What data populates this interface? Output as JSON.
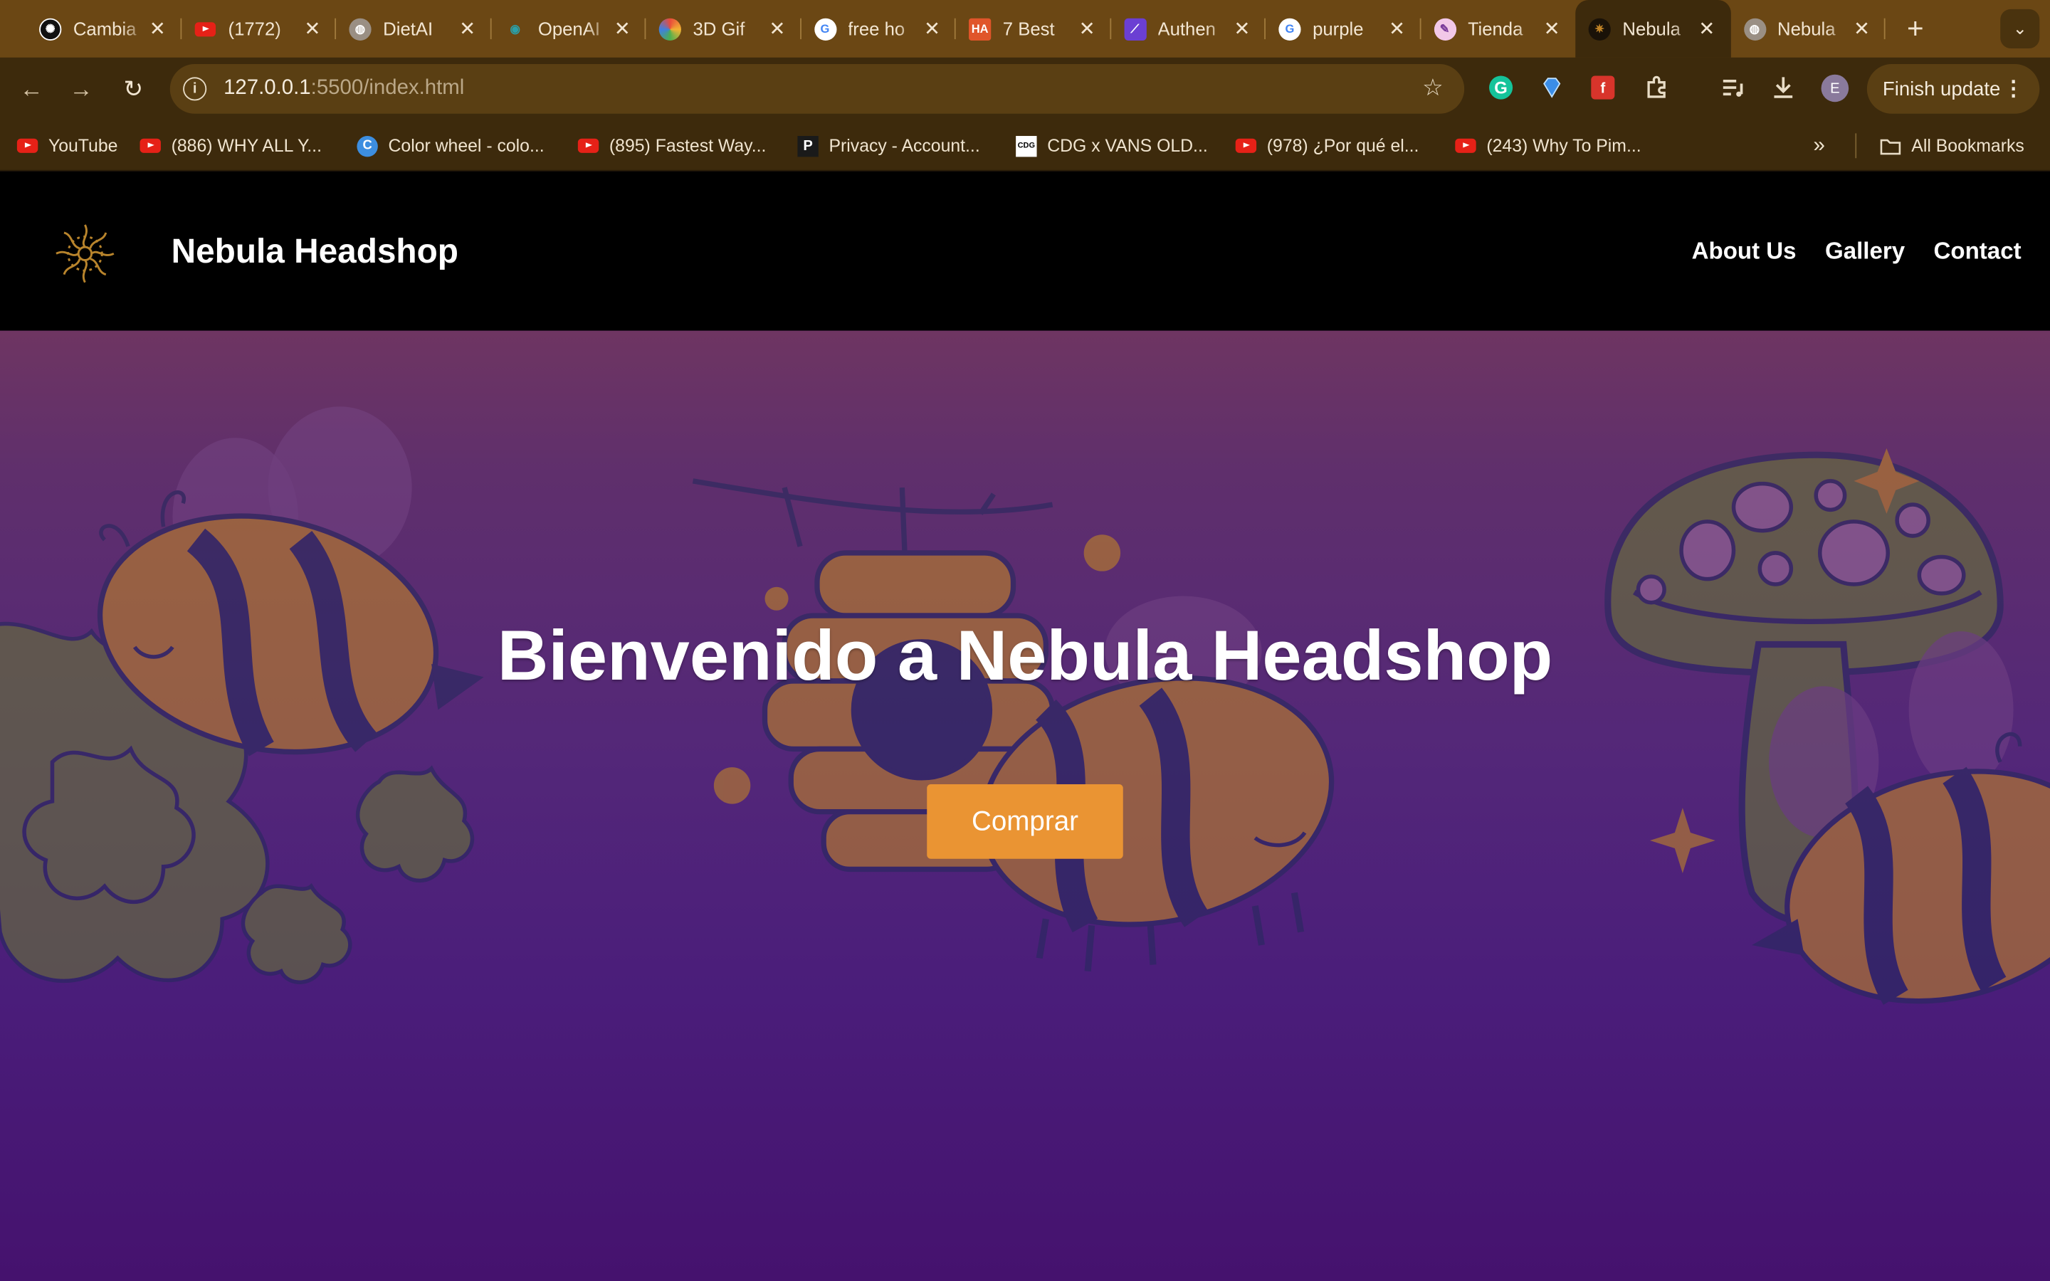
{
  "browser": {
    "tabs": [
      {
        "title": "Cambia",
        "favicon": "openai-icon",
        "color": "#111111"
      },
      {
        "title": "(1772)",
        "favicon": "youtube-icon",
        "color": "#e62117"
      },
      {
        "title": "DietAI",
        "favicon": "globe-icon",
        "color": "#9a8f84"
      },
      {
        "title": "OpenAI",
        "favicon": "openai-eye-icon",
        "color": "#1a5c6a"
      },
      {
        "title": "3D Gif",
        "favicon": "gif-icon",
        "color": "#d5a62c"
      },
      {
        "title": "free ho",
        "favicon": "google-icon",
        "color": "#ffffff"
      },
      {
        "title": "7 Best",
        "favicon": "ha-icon",
        "color": "#e0552a"
      },
      {
        "title": "Authen",
        "favicon": "auth-icon",
        "color": "#6b3fd3"
      },
      {
        "title": "purple",
        "favicon": "google-icon",
        "color": "#ffffff"
      },
      {
        "title": "Tienda",
        "favicon": "pencil-icon",
        "color": "#f2c8e8"
      },
      {
        "title": "Nebula",
        "favicon": "nebula-icon",
        "color": "#1a1208",
        "active": true
      },
      {
        "title": "Nebula",
        "favicon": "globe-icon",
        "color": "#9a8f84"
      }
    ],
    "new_tab_label": "+",
    "url_host": "127.0.0.1",
    "url_rest": ":5500/index.html",
    "finish_update_label": "Finish update",
    "avatar_letter": "E",
    "bookmarks": [
      {
        "label": "YouTube",
        "icon": "youtube-icon"
      },
      {
        "label": "(886) WHY ALL Y...",
        "icon": "youtube-icon"
      },
      {
        "label": "Color wheel - colo...",
        "icon": "canva-icon"
      },
      {
        "label": "(895) Fastest Way...",
        "icon": "youtube-icon"
      },
      {
        "label": "Privacy - Account...",
        "icon": "p-icon"
      },
      {
        "label": "CDG x VANS OLD...",
        "icon": "cdg-icon"
      },
      {
        "label": "(978) ¿Por qué el...",
        "icon": "youtube-icon"
      },
      {
        "label": "(243) Why To Pim...",
        "icon": "youtube-icon"
      }
    ],
    "all_bookmarks_label": "All Bookmarks"
  },
  "site": {
    "brand": "Nebula Headshop",
    "nav": [
      {
        "label": "About Us"
      },
      {
        "label": "Gallery"
      },
      {
        "label": "Contact"
      }
    ],
    "hero": {
      "headline": "Bienvenido a Nebula Headshop",
      "cta_label": "Comprar"
    }
  },
  "colors": {
    "chrome": "#6b4714",
    "toolbar": "#3d2a0c",
    "nav_bg": "#000000",
    "hero_top": "#6e3562",
    "hero_bottom": "#45126e",
    "cta": "#ea9433",
    "bee_yellow": "#c08326",
    "bee_navy": "#27295e",
    "leaf_green": "#667437"
  }
}
